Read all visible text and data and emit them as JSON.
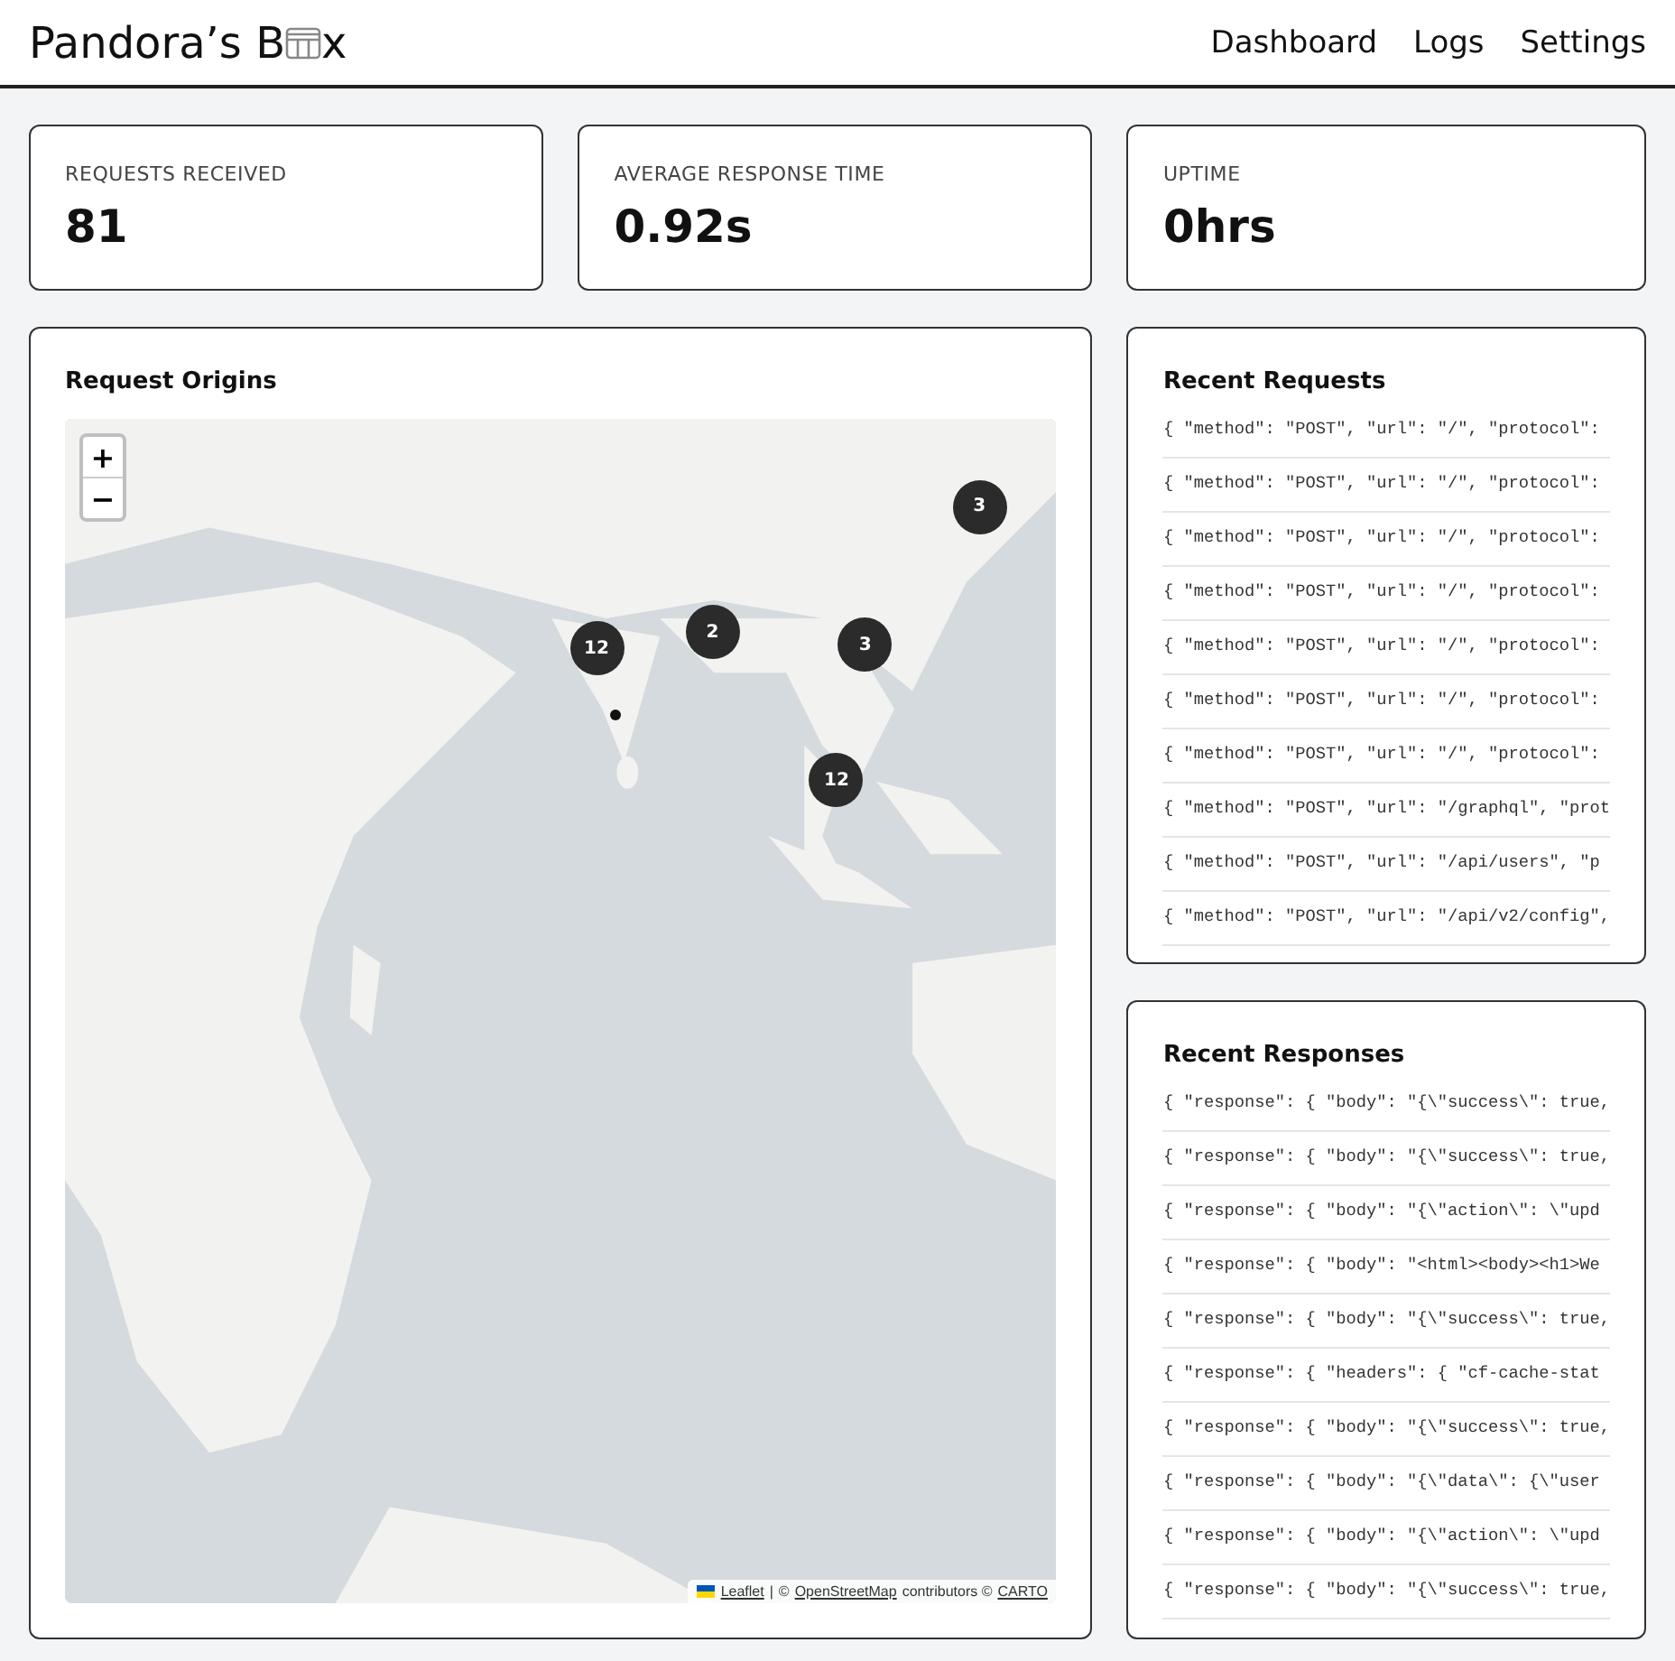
{
  "header": {
    "title_start": "Pandora’s B",
    "title_end": "x",
    "nav": [
      {
        "label": "Dashboard"
      },
      {
        "label": "Logs"
      },
      {
        "label": "Settings"
      }
    ]
  },
  "stats": [
    {
      "label": "REQUESTS RECEIVED",
      "value": "81"
    },
    {
      "label": "AVERAGE RESPONSE TIME",
      "value": "0.92s"
    },
    {
      "label": "UPTIME",
      "value": "0hrs"
    }
  ],
  "map": {
    "title": "Request Origins",
    "zoom_in": "+",
    "zoom_out": "−",
    "markers": [
      {
        "kind": "cluster",
        "label": "3"
      },
      {
        "kind": "cluster",
        "label": "2"
      },
      {
        "kind": "cluster",
        "label": "12"
      },
      {
        "kind": "cluster",
        "label": "3"
      },
      {
        "kind": "point"
      },
      {
        "kind": "cluster",
        "label": "12"
      }
    ],
    "attribution": {
      "leaflet": "Leaflet",
      "sep": "|",
      "copy1": "©",
      "osm": "OpenStreetMap",
      "contributors": "contributors ©",
      "carto": "CARTO"
    }
  },
  "recent_requests": {
    "title": "Recent Requests",
    "rows": [
      "{ \"method\": \"POST\", \"url\": \"/\", \"protocol\":",
      "{ \"method\": \"POST\", \"url\": \"/\", \"protocol\":",
      "{ \"method\": \"POST\", \"url\": \"/\", \"protocol\":",
      "{ \"method\": \"POST\", \"url\": \"/\", \"protocol\":",
      "{ \"method\": \"POST\", \"url\": \"/\", \"protocol\":",
      "{ \"method\": \"POST\", \"url\": \"/\", \"protocol\":",
      "{ \"method\": \"POST\", \"url\": \"/\", \"protocol\":",
      "{ \"method\": \"POST\", \"url\": \"/graphql\", \"prot",
      "{ \"method\": \"POST\", \"url\": \"/api/users\", \"p",
      "{ \"method\": \"POST\", \"url\": \"/api/v2/config\","
    ]
  },
  "recent_responses": {
    "title": "Recent Responses",
    "rows": [
      "{ \"response\": { \"body\": \"{\\\"success\\\": true,",
      "{ \"response\": { \"body\": \"{\\\"success\\\": true,",
      "{ \"response\": { \"body\": \"{\\\"action\\\": \\\"upd",
      "{ \"response\": { \"body\": \"<html><body><h1>We",
      "{ \"response\": { \"body\": \"{\\\"success\\\": true,",
      "{ \"response\": { \"headers\": { \"cf-cache-stat",
      "{ \"response\": { \"body\": \"{\\\"success\\\": true,",
      "{ \"response\": { \"body\": \"{\\\"data\\\": {\\\"user",
      "{ \"response\": { \"body\": \"{\\\"action\\\": \\\"upd",
      "{ \"response\": { \"body\": \"{\\\"success\\\": true,"
    ]
  }
}
